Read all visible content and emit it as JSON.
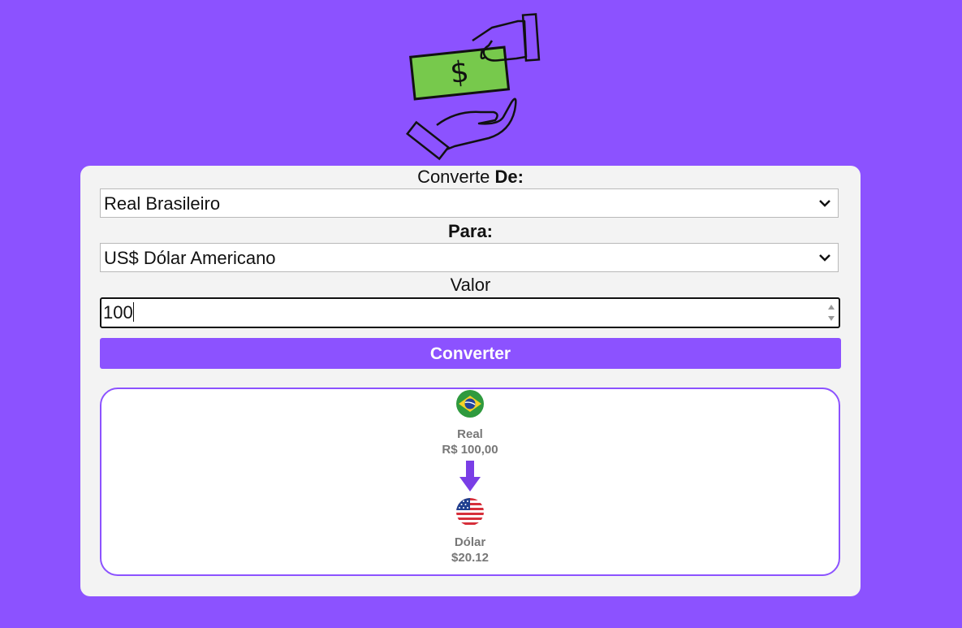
{
  "icons": {
    "hero": "money-exchange-hands-icon",
    "dropdown": "chevron-down-icon",
    "arrow": "arrow-down-icon",
    "from_flag": "brazil-flag-icon",
    "to_flag": "usa-flag-icon"
  },
  "form": {
    "from_label_prefix": "Converte",
    "from_label_bold": "De:",
    "from_selected": "Real Brasileiro",
    "to_label": "Para:",
    "to_selected": "US$ Dólar Americano",
    "value_label": "Valor",
    "value": "100",
    "submit_label": "Converter"
  },
  "result": {
    "from_name": "Real",
    "from_amount": "R$ 100,00",
    "to_name": "Dólar",
    "to_amount": "$20.12"
  },
  "colors": {
    "background": "#8c52ff",
    "card": "#f3f3f3",
    "arrow": "#7a3ee6",
    "banknote": "#77c94c"
  }
}
